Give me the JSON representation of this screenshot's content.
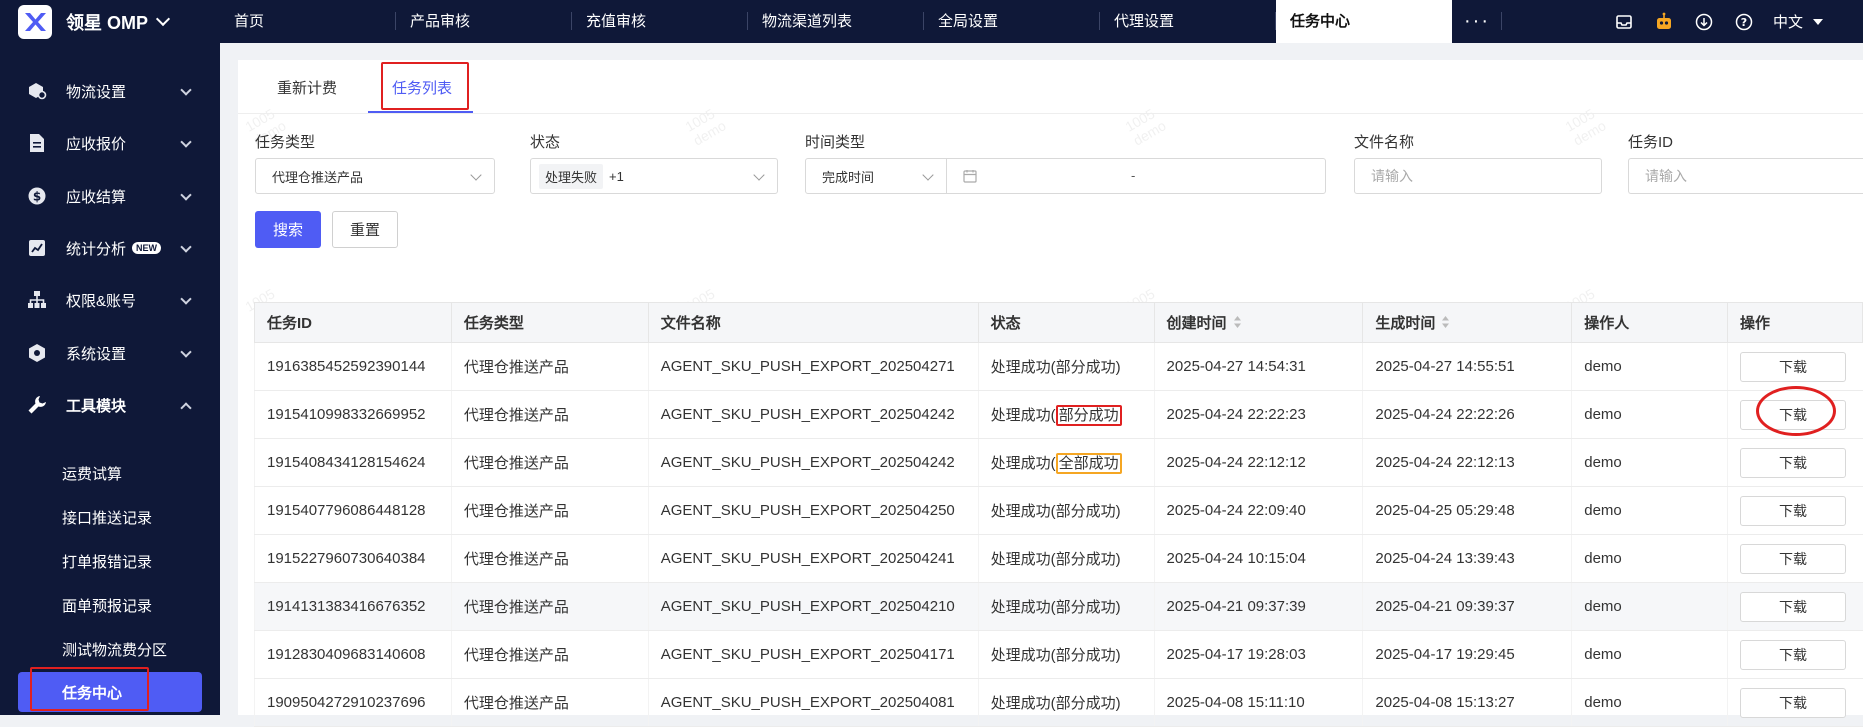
{
  "app": {
    "title": "领星 OMP"
  },
  "nav": {
    "tabs": [
      "首页",
      "产品审核",
      "充值审核",
      "物流渠道列表",
      "全局设置",
      "代理设置",
      "任务中心"
    ],
    "active_tab": "任务中心",
    "more": "···"
  },
  "header_right": {
    "language": "中文"
  },
  "sidebar": {
    "items": [
      {
        "label": "物流设置",
        "icon": "package-gear-icon"
      },
      {
        "label": "应收报价",
        "icon": "document-icon"
      },
      {
        "label": "应收结算",
        "icon": "dollar-icon"
      },
      {
        "label": "统计分析",
        "icon": "chart-icon",
        "badge": "NEW"
      },
      {
        "label": "权限&账号",
        "icon": "org-chart-icon"
      },
      {
        "label": "系统设置",
        "icon": "hexagon-gear-icon"
      },
      {
        "label": "工具模块",
        "icon": "wrench-icon",
        "expanded": true
      }
    ],
    "sub_items": [
      "运费试算",
      "接口推送记录",
      "打单报错记录",
      "面单预报记录",
      "测试物流费分区",
      "任务中心"
    ],
    "active_sub": "任务中心"
  },
  "page_tabs": [
    "重新计费",
    "任务列表"
  ],
  "active_page_tab": "任务列表",
  "filters": {
    "task_type": {
      "label": "任务类型",
      "value": "代理仓推送产品"
    },
    "status": {
      "label": "状态",
      "value": "处理失败",
      "extra": "+1"
    },
    "time_type": {
      "label": "时间类型",
      "value": "完成时间",
      "range_sep": "-"
    },
    "file_name": {
      "label": "文件名称",
      "placeholder": "请输入"
    },
    "task_id": {
      "label": "任务ID",
      "placeholder": "请输入"
    }
  },
  "buttons": {
    "search": "搜索",
    "reset": "重置"
  },
  "watermark": {
    "line1": "1005",
    "line2": "demo"
  },
  "table": {
    "columns": [
      "任务ID",
      "任务类型",
      "文件名称",
      "状态",
      "创建时间",
      "生成时间",
      "操作人",
      "操作"
    ],
    "rows": [
      {
        "id": "1916385452592390144",
        "type": "代理仓推送产品",
        "file": "AGENT_SKU_PUSH_EXPORT_202504271",
        "status_main": "处理成功(",
        "status_sub": "部分成功",
        "status_end": ")",
        "created": "2025-04-27 14:54:31",
        "generated": "2025-04-27 14:55:51",
        "operator": "demo",
        "action": "下载"
      },
      {
        "id": "1915410998332669952",
        "type": "代理仓推送产品",
        "file": "AGENT_SKU_PUSH_EXPORT_202504242",
        "status_main": "处理成功(",
        "status_sub": "部分成功",
        "status_end": ")",
        "created": "2025-04-24 22:22:23",
        "generated": "2025-04-24 22:22:26",
        "operator": "demo",
        "action": "下载"
      },
      {
        "id": "1915408434128154624",
        "type": "代理仓推送产品",
        "file": "AGENT_SKU_PUSH_EXPORT_202504242",
        "status_main": "处理成功(",
        "status_sub": "全部成功",
        "status_end": ")",
        "created": "2025-04-24 22:12:12",
        "generated": "2025-04-24 22:12:13",
        "operator": "demo",
        "action": "下载"
      },
      {
        "id": "1915407796086448128",
        "type": "代理仓推送产品",
        "file": "AGENT_SKU_PUSH_EXPORT_202504250",
        "status_main": "处理成功(",
        "status_sub": "部分成功",
        "status_end": ")",
        "created": "2025-04-24 22:09:40",
        "generated": "2025-04-25 05:29:48",
        "operator": "demo",
        "action": "下载"
      },
      {
        "id": "1915227960730640384",
        "type": "代理仓推送产品",
        "file": "AGENT_SKU_PUSH_EXPORT_202504241",
        "status_main": "处理成功(",
        "status_sub": "部分成功",
        "status_end": ")",
        "created": "2025-04-24 10:15:04",
        "generated": "2025-04-24 13:39:43",
        "operator": "demo",
        "action": "下载"
      },
      {
        "id": "1914131383416676352",
        "type": "代理仓推送产品",
        "file": "AGENT_SKU_PUSH_EXPORT_202504210",
        "status_main": "处理成功(",
        "status_sub": "部分成功",
        "status_end": ")",
        "created": "2025-04-21 09:37:39",
        "generated": "2025-04-21 09:39:37",
        "operator": "demo",
        "action": "下载"
      },
      {
        "id": "1912830409683140608",
        "type": "代理仓推送产品",
        "file": "AGENT_SKU_PUSH_EXPORT_202504171",
        "status_main": "处理成功(",
        "status_sub": "部分成功",
        "status_end": ")",
        "created": "2025-04-17 19:28:03",
        "generated": "2025-04-17 19:29:45",
        "operator": "demo",
        "action": "下载"
      },
      {
        "id": "1909504272910237696",
        "type": "代理仓推送产品",
        "file": "AGENT_SKU_PUSH_EXPORT_202504081",
        "status_main": "处理成功(",
        "status_sub": "部分成功",
        "status_end": ")",
        "created": "2025-04-08 15:11:10",
        "generated": "2025-04-08 15:13:27",
        "operator": "demo",
        "action": "下载"
      }
    ]
  },
  "colors": {
    "brand_dark": "#0f1838",
    "accent": "#4f5cf4",
    "highlight_red": "#e02020",
    "highlight_orange": "#f5a623"
  }
}
